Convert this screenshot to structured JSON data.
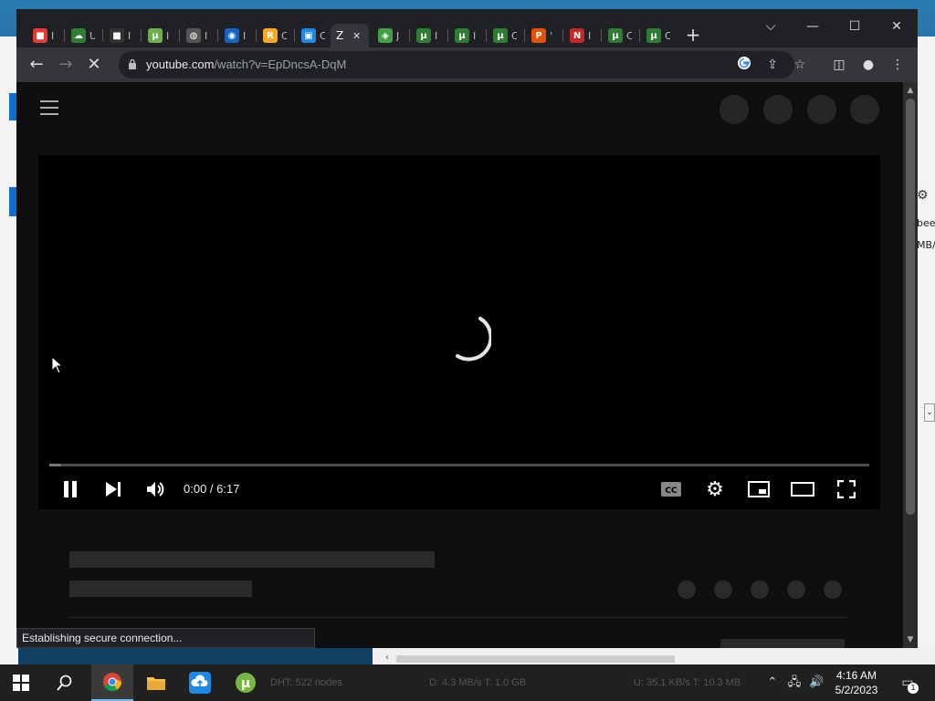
{
  "browser": {
    "tabs": [
      {
        "title": "I",
        "color": "#e53935",
        "glyph": "■"
      },
      {
        "title": "U",
        "color": "#2e7d32",
        "glyph": "☁"
      },
      {
        "title": "I",
        "color": "#333333",
        "glyph": "■"
      },
      {
        "title": "I",
        "color": "#6ab04c",
        "glyph": "µ"
      },
      {
        "title": "I",
        "color": "#555555",
        "glyph": "◍"
      },
      {
        "title": "I",
        "color": "#1565c0",
        "glyph": "◉"
      },
      {
        "title": "C",
        "color": "#f9a825",
        "glyph": "R"
      },
      {
        "title": "C",
        "color": "#1e88e5",
        "glyph": "▣"
      },
      {
        "title": "Z",
        "color": "#35363a",
        "glyph": ""
      },
      {
        "title": "J",
        "color": "#43a047",
        "glyph": "◈"
      },
      {
        "title": "I",
        "color": "#2e7d32",
        "glyph": "µ"
      },
      {
        "title": "I",
        "color": "#2e7d32",
        "glyph": "µ"
      },
      {
        "title": "C",
        "color": "#2e7d32",
        "glyph": "µ"
      },
      {
        "title": "'",
        "color": "#e65100",
        "glyph": "P"
      },
      {
        "title": "I",
        "color": "#c62828",
        "glyph": "N"
      },
      {
        "title": "C",
        "color": "#2e7d32",
        "glyph": "µ"
      },
      {
        "title": "C",
        "color": "#2e7d32",
        "glyph": "µ"
      }
    ],
    "active_tab_title": "Z",
    "url_host": "youtube.com",
    "url_path": "/watch?v=EpDncsA-DqM",
    "status_text": "Establishing secure connection..."
  },
  "player": {
    "time_display": "0:00 / 6:17",
    "progress": 0.015
  },
  "background": {
    "right_texts": [
      "bee",
      "MB/"
    ]
  },
  "taskbar": {
    "dht": "DHT: 522 nodes",
    "down": "D: 4.3 MB/s T: 1.0 GB",
    "up": "U: 35.1 KB/s T: 10.3 MB",
    "time": "4:16 AM",
    "date": "5/2/2023",
    "notification_count": "1"
  }
}
